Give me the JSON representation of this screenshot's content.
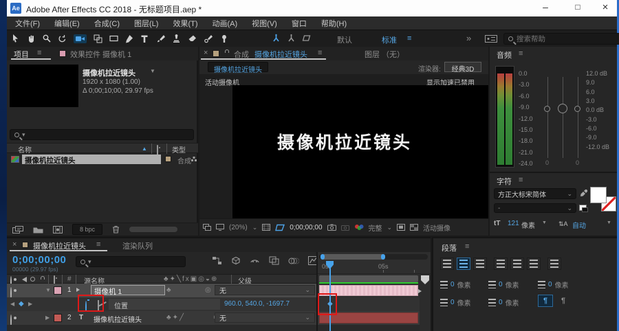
{
  "window": {
    "app_badge": "Ae",
    "title": "Adobe After Effects CC 2018 - 无标题项目.aep *"
  },
  "menu": {
    "items": [
      "文件(F)",
      "编辑(E)",
      "合成(C)",
      "图层(L)",
      "效果(T)",
      "动画(A)",
      "视图(V)",
      "窗口",
      "帮助(H)"
    ]
  },
  "toolbar": {
    "workspace_default": "默认",
    "workspace_standard": "标准",
    "more": "»",
    "search_placeholder": "搜索帮助"
  },
  "project": {
    "tab": "项目",
    "tab_effect_controls": "效果控件 摄像机 1",
    "comp_name": "摄像机拉近镜头",
    "dimensions": "1920 x 1080 (1.00)",
    "duration": "Δ 0;00;10;00, 29.97 fps",
    "col_name": "名称",
    "col_type": "类型",
    "item_name": "摄像机拉近镜头",
    "item_type": "合成",
    "color_depth": "8 bpc"
  },
  "comp": {
    "tab_prefix": "合成",
    "tab_name": "摄像机拉近镜头",
    "tab_layer": "图层 （无）",
    "breadcrumb": "摄像机拉近镜头",
    "renderer_label": "渲染器:",
    "renderer_value": "经典3D",
    "view_label": "活动摄像机",
    "accel_note": "显示加速已禁用",
    "canvas_text": "摄像机拉近镜头",
    "zoom_level": "(20%)",
    "timecode": "0;00;00;00",
    "resolution": "完整",
    "camera_view": "活动摄像"
  },
  "audio": {
    "title": "音频",
    "left_scale": [
      "0.0",
      "-3.0",
      "-6.0",
      "-9.0",
      "-12.0",
      "-15.0",
      "-18.0",
      "-21.0",
      "-24.0"
    ],
    "right_scale": [
      "12.0 dB",
      "9.0",
      "6.0",
      "3.0",
      "0.0 dB",
      "-3.0",
      "-6.0",
      "-9.0",
      "-12.0 dB"
    ],
    "slider_left_value": "0",
    "slider_right_value": "0"
  },
  "character": {
    "title": "字符",
    "font_family": "方正大标宋简体",
    "font_style": "-",
    "font_size": "121",
    "size_unit": "像素",
    "leading_value": "自动"
  },
  "paragraph": {
    "title": "段落",
    "indent_values": [
      "0",
      "0",
      "0",
      "0",
      "0"
    ],
    "unit": "像素"
  },
  "timeline": {
    "tab_name": "摄像机拉近镜头",
    "tab_render_queue": "渲染队列",
    "timecode": "0;00;00;00",
    "frame_info": "00000 (29.97 fps)",
    "col_source_name": "源名称",
    "col_parent": "父级",
    "ruler_start": "0s",
    "ruler_mid": "05s",
    "layer1": {
      "num": "1",
      "name": "摄像机 1",
      "parent": "无"
    },
    "property": {
      "name": "位置",
      "value": "960.0, 540.0, -1697.7"
    },
    "layer2": {
      "num": "2",
      "name": "摄像机拉近镜头",
      "parent": "无"
    }
  },
  "glyphs": {
    "hamburger": "≡",
    "close": "×",
    "sort_up": "▲",
    "chevron_down": "⌄",
    "expand_open": "▼",
    "expand_closed": "▶",
    "name_arrow": "▼",
    "dropdown_small": "▾",
    "kf_prev": "◀",
    "kf_diamond": "◆",
    "kf_next": "▶",
    "switches_header": "♣✦╲fx▣◎◒⊕",
    "switch_q": "♣",
    "switch_row2": "♣✦╱",
    "switch_3d": "⊕",
    "pickwhip": "◎",
    "hash": "#",
    "text_layer": "T",
    "size_icon": "tT",
    "leading_icon": "⇅A",
    "para_mark": "¶",
    "minimize": "–",
    "maximize": "□"
  }
}
